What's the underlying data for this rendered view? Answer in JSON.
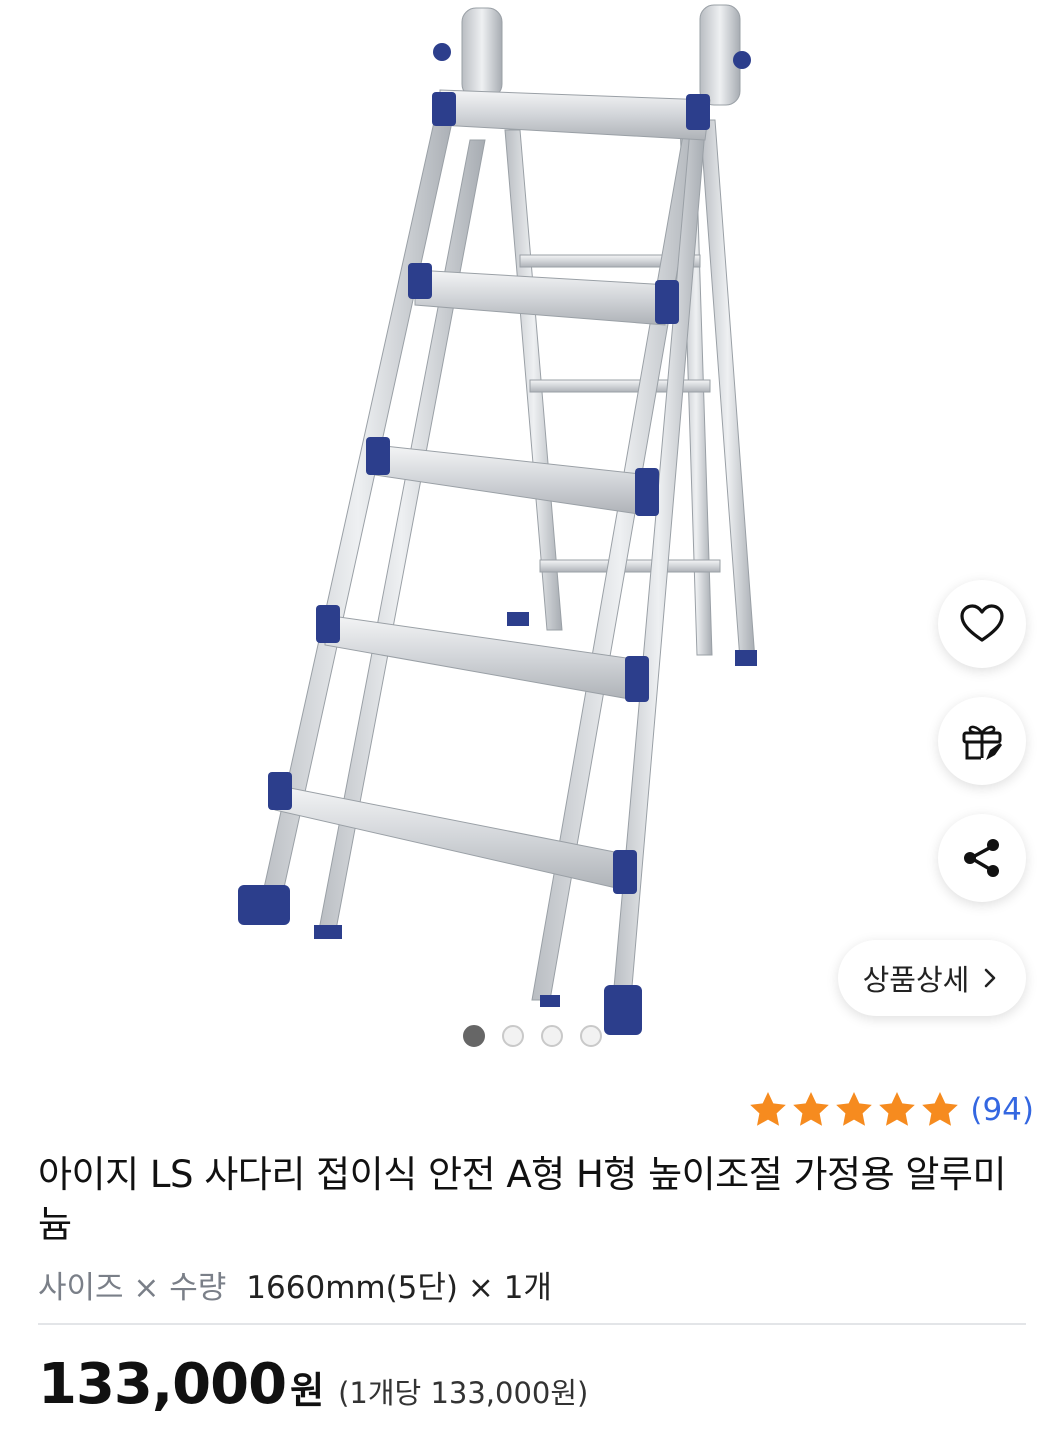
{
  "product": {
    "image_alt": "aluminum multi-purpose ladder",
    "title": "아이지 LS 사다리 접이식 안전 A형 H형 높이조절 가정용 알루미늄",
    "rating_count": "(94)",
    "rating_stars": 5,
    "options_label": "사이즈 × 수량",
    "options_value": "1660mm(5단) × 1개",
    "price": "133,000",
    "price_unit": "원",
    "unit_price": "(1개당 133,000원)"
  },
  "actions": {
    "detail_label": "상품상세"
  },
  "gallery": {
    "page_count": 4,
    "active_index": 0
  },
  "colors": {
    "star": "#f68b1f",
    "link": "#3467e1",
    "ladder_cap": "#2c3e8c"
  }
}
